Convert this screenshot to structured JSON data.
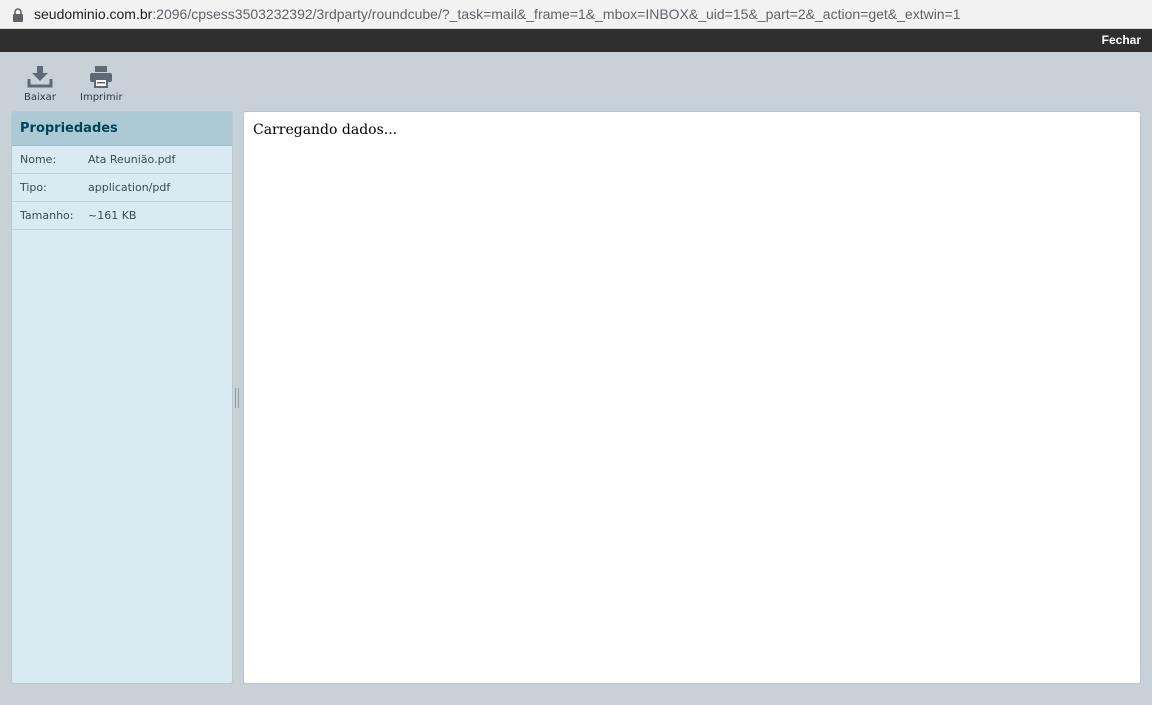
{
  "browser": {
    "url_host": "seudominio.com.br",
    "url_rest": ":2096/cpsess3503232392/3rdparty/roundcube/?_task=mail&_frame=1&_mbox=INBOX&_uid=15&_part=2&_action=get&_extwin=1"
  },
  "topbar": {
    "close_label": "Fechar"
  },
  "toolbar": {
    "download_label": "Baixar",
    "print_label": "Imprimir"
  },
  "sidebar": {
    "title": "Propriedades",
    "properties": [
      {
        "key": "Nome:",
        "value": "Ata Reunião.pdf"
      },
      {
        "key": "Tipo:",
        "value": "application/pdf"
      },
      {
        "key": "Tamanho:",
        "value": "~161 KB"
      }
    ]
  },
  "content": {
    "status_text": "Carregando dados..."
  },
  "colors": {
    "background": "#c9d1d8",
    "topbar": "#2f2f2f",
    "sidebar_header": "#abcad6",
    "sidebar_body": "#d9eaf2",
    "title_text": "#004458"
  }
}
